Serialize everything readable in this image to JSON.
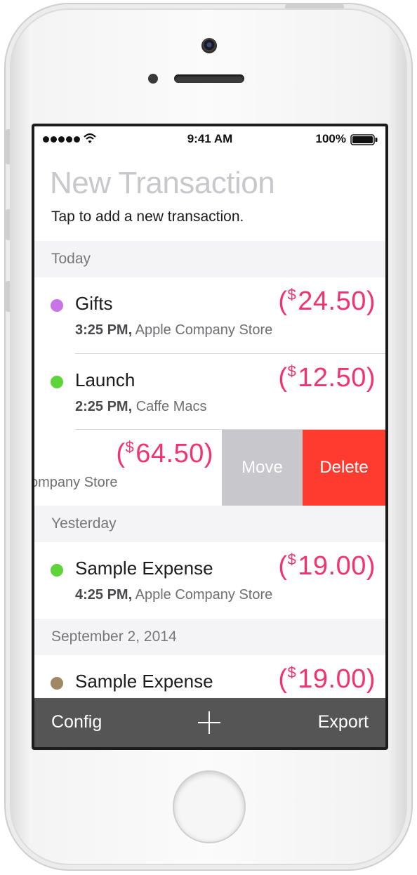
{
  "status_bar": {
    "time": "9:41 AM",
    "battery": "100%",
    "icons": [
      "signal-dots-icon",
      "wifi-icon",
      "battery-icon"
    ]
  },
  "header": {
    "title": "New Transaction",
    "subtitle": "Tap to add a new transaction."
  },
  "sections": [
    {
      "header": "Today",
      "rows": [
        {
          "title": "Gifts",
          "time": "3:25 PM,",
          "place": "Apple Company Store",
          "amount_open": "(",
          "currency": "$",
          "amount": "24.50",
          "amount_close": ")",
          "dot_color": "#c874e6"
        },
        {
          "title": "Launch",
          "time": "2:25 PM,",
          "place": "Caffe Macs",
          "amount_open": "(",
          "currency": "$",
          "amount": "12.50",
          "amount_close": ")",
          "dot_color": "#5fd43a"
        },
        {
          "title": "",
          "time": "",
          "place": "ompany Store",
          "amount_open": "(",
          "currency": "$",
          "amount": "64.50",
          "amount_close": ")",
          "actions": {
            "move": "Move",
            "delete": "Delete"
          }
        }
      ]
    },
    {
      "header": "Yesterday",
      "rows": [
        {
          "title": "Sample Expense",
          "time": "4:25 PM,",
          "place": "Apple Company Store",
          "amount_open": "(",
          "currency": "$",
          "amount": "19.00",
          "amount_close": ")",
          "dot_color": "#5fd43a"
        }
      ]
    },
    {
      "header": "September 2, 2014",
      "rows": [
        {
          "title": "Sample Expense",
          "amount_open": "(",
          "currency": "$",
          "amount": "19.00",
          "amount_close": ")",
          "dot_color": "#a08866"
        }
      ]
    }
  ],
  "toolbar": {
    "config": "Config",
    "add_icon": "plus-icon",
    "export": "Export"
  },
  "colors": {
    "amount": "#f3336f",
    "delete": "#ff3b30",
    "move": "#c7c7cc",
    "toolbar": "#505050"
  }
}
